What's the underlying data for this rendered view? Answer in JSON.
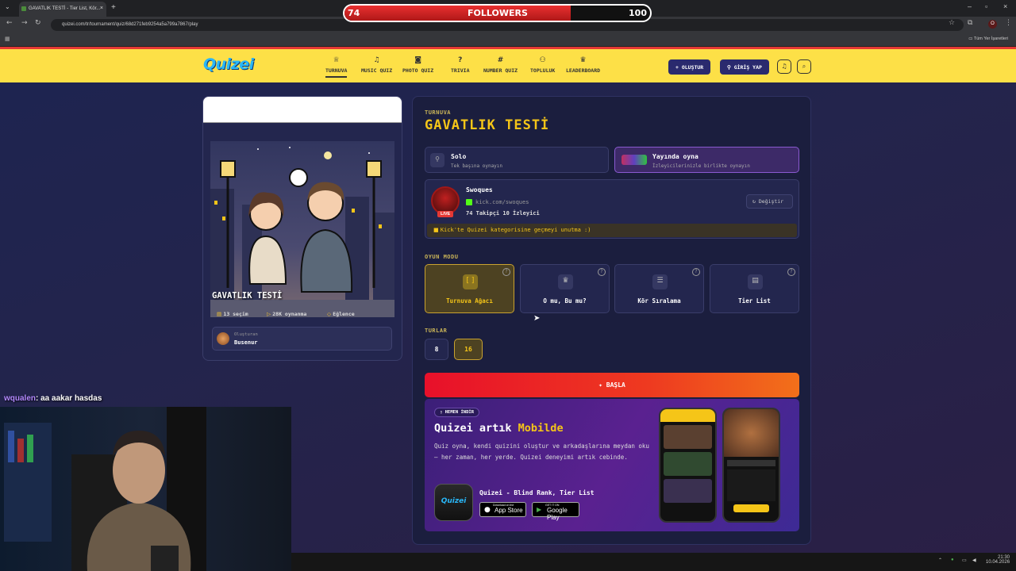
{
  "browser": {
    "tab_title": "GAVATLIK TESTİ - Tier List, Kör...",
    "url": "quizei.com/tr/tournament/quiz/68d271feb9254a5a799a7867/play",
    "bookmarks_label": "Tüm Yer İşaretleri"
  },
  "overlay": {
    "current": "74",
    "label": "FOLLOWERS",
    "goal": "100",
    "progress": 0.74
  },
  "site": {
    "logo": "Quizei",
    "nav": [
      {
        "label": "TURNUVA",
        "icon": "trophy-icon"
      },
      {
        "label": "MUSIC QUIZ",
        "icon": "music-icon"
      },
      {
        "label": "PHOTO QUIZ",
        "icon": "camera-icon"
      },
      {
        "label": "TRIVIA",
        "icon": "question-icon"
      },
      {
        "label": "NUMBER QUIZ",
        "icon": "hash-icon"
      },
      {
        "label": "TOPLULUK",
        "icon": "users-icon"
      },
      {
        "label": "LEADERBOARD",
        "icon": "medal-icon"
      }
    ],
    "create_button": "OLUŞTUR",
    "login_button": "GİRİŞ YAP"
  },
  "quiz_card": {
    "title": "GAVATLIK TESTİ",
    "choices": "13 seçim",
    "plays": "28K oynanma",
    "category": "Eğlence",
    "creator_label": "Oluşturan",
    "creator_name": "Busenur"
  },
  "panel": {
    "section_label": "TURNUVA",
    "title": "GAVATLIK TESTİ",
    "solo": {
      "title": "Solo",
      "subtitle": "Tek başına oynayın"
    },
    "live": {
      "title": "Yayında oyna",
      "subtitle": "İzleyicilerinizle birlikte oynayın"
    },
    "streamer": {
      "name": "Swoques",
      "channel": "kick.com/swoques",
      "stats": "74 Takipçi 10 İzleyici",
      "live_badge": "LIVE",
      "change_button": "Değiştir",
      "notice": "Kick'te Quizei kategorisine geçmeyi unutma :)"
    },
    "mode_label": "OYUN MODU",
    "modes": [
      "Turnuva Ağacı",
      "O mu, Bu mu?",
      "Kör Sıralama",
      "Tier List"
    ],
    "rounds_label": "TURLAR",
    "rounds": [
      "8",
      "16"
    ],
    "start_button": "BAŞLA"
  },
  "promo": {
    "badge": "HEMEN İNDİR",
    "title_a": "Quizei artık ",
    "title_b": "Mobilde",
    "text": "Quiz oyna, kendi quizini oluştur ve arkadaşlarına meydan oku — her zaman, her yerde. Quizei deneyimi artık cebinde.",
    "app_name": "Quizei - Blind Rank, Tier List",
    "app_store_small": "Download on the",
    "app_store": "App Store",
    "google_small": "GET IT ON",
    "google": "Google Play"
  },
  "stream": {
    "chat_user": "wqualen",
    "chat_message": ": aa aakar hasdas"
  },
  "taskbar": {
    "time": "21:30",
    "date": "10.04.2026"
  }
}
